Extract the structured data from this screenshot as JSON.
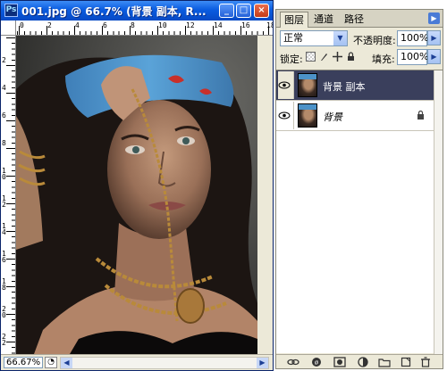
{
  "document": {
    "title": "001.jpg @ 66.7% (背景 副本, R...",
    "app_icon_label": "Ps",
    "zoom_status": "66.67%",
    "ruler_top_labels": [
      "0",
      "2",
      "4",
      "6",
      "8",
      "10",
      "12",
      "14",
      "16",
      "18"
    ],
    "ruler_left_labels": [
      "2",
      "4",
      "6",
      "8",
      "10",
      "12",
      "14",
      "16",
      "18",
      "20",
      "22"
    ],
    "window_buttons": {
      "minimize": "_",
      "maximize": "□",
      "close": "×"
    }
  },
  "layers_panel": {
    "tabs": [
      {
        "label": "图层",
        "active": true
      },
      {
        "label": "通道",
        "active": false
      },
      {
        "label": "路径",
        "active": false
      }
    ],
    "blend_mode": "正常",
    "opacity_label": "不透明度:",
    "opacity_value": "100%",
    "lock_label": "锁定:",
    "fill_label": "填充:",
    "fill_value": "100%",
    "layers": [
      {
        "name": "背景 副本",
        "selected": true,
        "visible": true,
        "locked": false
      },
      {
        "name": "背景",
        "selected": false,
        "visible": true,
        "locked": true
      }
    ],
    "footer_icons": [
      "link-icon",
      "fx-icon",
      "mask-icon",
      "adjustment-icon",
      "folder-icon",
      "new-layer-icon",
      "trash-icon"
    ]
  },
  "colors": {
    "titlebar_blue": "#0a5ce0",
    "selected_layer_bg": "#3a3f5c",
    "bandana_blue": "#4c92c8",
    "panel_bg": "#ece9d8"
  }
}
